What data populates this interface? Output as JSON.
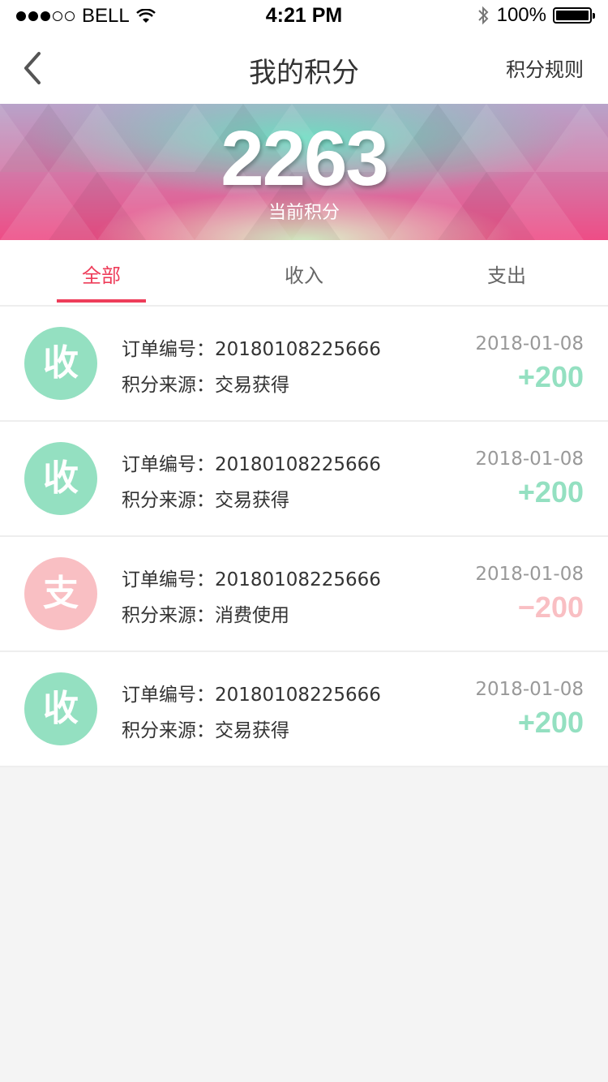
{
  "status": {
    "carrier": "BELL",
    "time": "4:21 PM",
    "battery": "100%"
  },
  "nav": {
    "title": "我的积分",
    "right": "积分规则"
  },
  "banner": {
    "points": "2263",
    "label": "当前积分"
  },
  "tabs": [
    {
      "label": "全部"
    },
    {
      "label": "收入"
    },
    {
      "label": "支出"
    }
  ],
  "records": [
    {
      "badge": "收",
      "order": "订单编号：20180108225666",
      "source": "积分来源：交易获得",
      "date": "2018-01-08",
      "amount": "+200"
    },
    {
      "badge": "收",
      "order": "订单编号：20180108225666",
      "source": "积分来源：交易获得",
      "date": "2018-01-08",
      "amount": "+200"
    },
    {
      "badge": "支",
      "order": "订单编号：20180108225666",
      "source": "积分来源：消费使用",
      "date": "2018-01-08",
      "amount": "−200"
    },
    {
      "badge": "收",
      "order": "订单编号：20180108225666",
      "source": "积分来源：交易获得",
      "date": "2018-01-08",
      "amount": "+200"
    }
  ],
  "colors": {
    "accent": "#ee3d5a",
    "income": "#94e0c1",
    "expense": "#f9bfc3"
  }
}
